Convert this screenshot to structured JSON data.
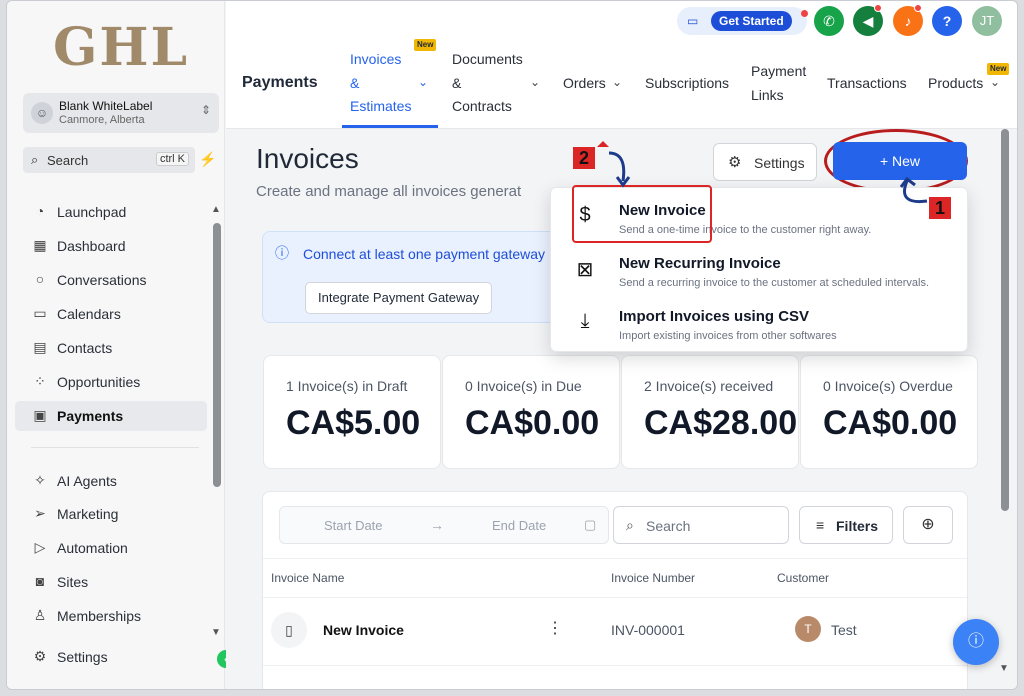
{
  "brand": {
    "logo_text": "GHL"
  },
  "account": {
    "name": "Blank WhiteLabel",
    "location": "Canmore, Alberta"
  },
  "sidebar": {
    "search_label": "Search",
    "search_shortcut": "ctrl K",
    "items": [
      {
        "label": "Launchpad",
        "icon": "launchpad-icon"
      },
      {
        "label": "Dashboard",
        "icon": "dashboard-icon"
      },
      {
        "label": "Conversations",
        "icon": "chat-bubble-icon"
      },
      {
        "label": "Calendars",
        "icon": "calendar-icon"
      },
      {
        "label": "Contacts",
        "icon": "contacts-icon"
      },
      {
        "label": "Opportunities",
        "icon": "opportunities-icon"
      },
      {
        "label": "Payments",
        "icon": "payments-icon",
        "active": true
      },
      {
        "label": "AI Agents",
        "icon": "sparkle-icon"
      },
      {
        "label": "Marketing",
        "icon": "send-icon"
      },
      {
        "label": "Automation",
        "icon": "automation-icon"
      },
      {
        "label": "Sites",
        "icon": "sites-icon"
      },
      {
        "label": "Memberships",
        "icon": "memberships-icon"
      },
      {
        "label": "Settings",
        "icon": "gear-icon"
      }
    ]
  },
  "topbar": {
    "get_started": "Get Started",
    "user_initials": "JT",
    "help": "?",
    "section_title": "Payments",
    "tabs": [
      {
        "label": "Invoices & Estimates",
        "line1": "Invoices",
        "line2": "&",
        "line3": "Estimates",
        "badge": "New",
        "active": true
      },
      {
        "label": "Documents & Contracts",
        "line1": "Documents",
        "line2": "&",
        "line3": "Contracts"
      },
      {
        "label": "Orders"
      },
      {
        "label": "Subscriptions"
      },
      {
        "label": "Payment Links",
        "line1": "Payment",
        "line2": "Links"
      },
      {
        "label": "Transactions"
      },
      {
        "label": "Products",
        "badge": "New"
      }
    ]
  },
  "page": {
    "title": "Invoices",
    "subtitle": "Create and manage all invoices generat",
    "settings_label": "Settings",
    "new_label": "+ New"
  },
  "banner": {
    "text": "Connect at least one payment gateway",
    "button": "Integrate Payment Gateway"
  },
  "stats": [
    {
      "label": "1 Invoice(s) in Draft",
      "value": "CA$5.00"
    },
    {
      "label": "0 Invoice(s) in Due",
      "value": "CA$0.00"
    },
    {
      "label": "2 Invoice(s) received",
      "value": "CA$28.00"
    },
    {
      "label": "0 Invoice(s) Overdue",
      "value": "CA$0.00"
    }
  ],
  "table": {
    "start_date": "Start Date",
    "end_date": "End Date",
    "search_placeholder": "Search",
    "filters_label": "Filters",
    "columns": [
      "Invoice Name",
      "Invoice Number",
      "Customer"
    ],
    "rows": [
      {
        "name": "New Invoice",
        "number": "INV-000001",
        "customer": "Test",
        "customer_initial": "T"
      }
    ]
  },
  "dropdown": {
    "items": [
      {
        "title": "New Invoice",
        "desc": "Send a one-time invoice to the customer right away.",
        "icon": "dollar-icon"
      },
      {
        "title": "New Recurring Invoice",
        "desc": "Send a recurring invoice to the customer at scheduled intervals.",
        "icon": "recurring-invoice-icon"
      },
      {
        "title": "Import Invoices using CSV",
        "desc": "Import existing invoices from other softwares",
        "icon": "download-icon"
      }
    ]
  },
  "annotations": {
    "step1": "1",
    "step2": "2"
  },
  "colors": {
    "accent": "#2563eb",
    "annotation_red": "#dc2626",
    "brand_gold": "#a08a6a"
  }
}
